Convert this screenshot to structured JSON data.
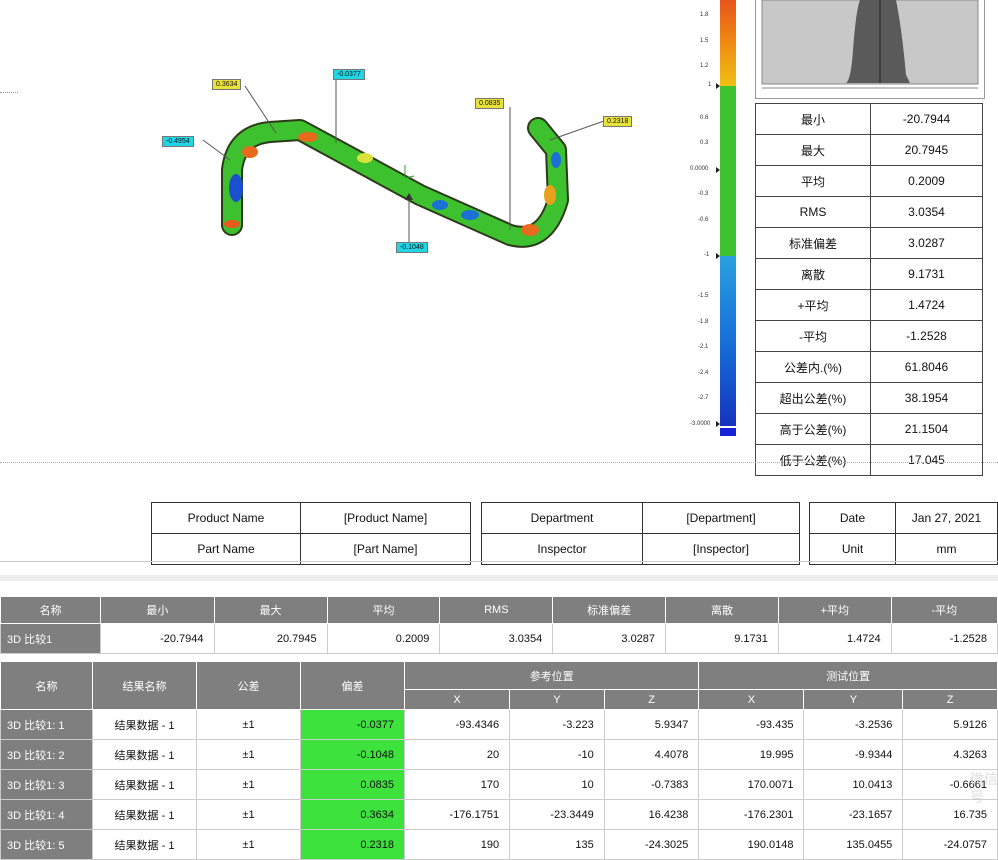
{
  "callouts": [
    {
      "value": "0.3634",
      "color": "yellow"
    },
    {
      "value": "-0.0377",
      "color": "cyan"
    },
    {
      "value": "-0.4954",
      "color": "cyan"
    },
    {
      "value": "0.0835",
      "color": "yellow"
    },
    {
      "value": "0.2318",
      "color": "yellow"
    },
    {
      "value": "-0.1048",
      "color": "cyan"
    }
  ],
  "scale": {
    "upper_ticks": [
      "1.8",
      "1.5",
      "1.2",
      "1",
      "0.6",
      "0.3",
      "0.0000",
      "-0.3",
      "-0.6",
      "-1"
    ],
    "lower_ticks": [
      "-1.5",
      "-1.8",
      "-2.1",
      "-2.4",
      "-2.7",
      "-3.0000"
    ]
  },
  "stats": [
    {
      "label": "最小",
      "value": "-20.7944"
    },
    {
      "label": "最大",
      "value": "20.7945"
    },
    {
      "label": "平均",
      "value": "0.2009"
    },
    {
      "label": "RMS",
      "value": "3.0354"
    },
    {
      "label": "标准偏差",
      "value": "3.0287"
    },
    {
      "label": "离散",
      "value": "9.1731"
    },
    {
      "label": "+平均",
      "value": "1.4724"
    },
    {
      "label": "-平均",
      "value": "-1.2528"
    },
    {
      "label": "公差内.(%)",
      "value": "61.8046"
    },
    {
      "label": "超出公差(%)",
      "value": "38.1954"
    },
    {
      "label": "高于公差(%)",
      "value": "21.1504"
    },
    {
      "label": "低于公差(%)",
      "value": "17.045"
    }
  ],
  "info": {
    "product_label": "Product Name",
    "product_value": "[Product Name]",
    "part_label": "Part Name",
    "part_value": "[Part Name]",
    "dept_label": "Department",
    "dept_value": "[Department]",
    "inspector_label": "Inspector",
    "inspector_value": "[Inspector]",
    "date_label": "Date",
    "date_value": "Jan 27, 2021",
    "unit_label": "Unit",
    "unit_value": "mm"
  },
  "summary": {
    "headers": [
      "名称",
      "最小",
      "最大",
      "平均",
      "RMS",
      "标准偏差",
      "离散",
      "+平均",
      "-平均"
    ],
    "row": [
      "3D 比较1",
      "-20.7944",
      "20.7945",
      "0.2009",
      "3.0354",
      "3.0287",
      "9.1731",
      "1.4724",
      "-1.2528"
    ]
  },
  "results": {
    "headers": {
      "name": "名称",
      "result": "结果名称",
      "tol": "公差",
      "dev": "偏差",
      "ref": "参考位置",
      "test": "测试位置",
      "x": "X",
      "y": "Y",
      "z": "Z"
    },
    "rows": [
      [
        "3D 比较1: 1",
        "结果数据 - 1",
        "±1",
        "-0.0377",
        "-93.4346",
        "-3.223",
        "5.9347",
        "-93.435",
        "-3.2536",
        "5.9126"
      ],
      [
        "3D 比较1: 2",
        "结果数据 - 1",
        "±1",
        "-0.1048",
        "20",
        "-10",
        "4.4078",
        "19.995",
        "-9.9344",
        "4.3263"
      ],
      [
        "3D 比较1: 3",
        "结果数据 - 1",
        "±1",
        "0.0835",
        "170",
        "10",
        "-0.7383",
        "170.0071",
        "10.0413",
        "-0.6661"
      ],
      [
        "3D 比较1: 4",
        "结果数据 - 1",
        "±1",
        "0.3634",
        "-176.1751",
        "-23.3449",
        "16.4238",
        "-176.2301",
        "-23.1657",
        "16.735"
      ],
      [
        "3D 比较1: 5",
        "结果数据 - 1",
        "±1",
        "0.2318",
        "190",
        "135",
        "-24.3025",
        "190.0148",
        "135.0455",
        "-24.0757"
      ]
    ]
  }
}
